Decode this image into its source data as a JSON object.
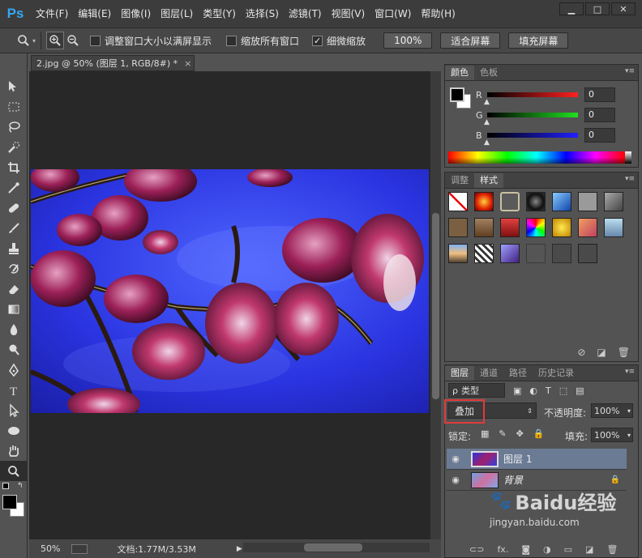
{
  "app": {
    "logo": "Ps"
  },
  "menu": [
    "文件(F)",
    "编辑(E)",
    "图像(I)",
    "图层(L)",
    "类型(Y)",
    "选择(S)",
    "滤镜(T)",
    "视图(V)",
    "窗口(W)",
    "帮助(H)"
  ],
  "window_controls": {
    "minimize": "▁",
    "maximize": "□",
    "close": "✕"
  },
  "options": {
    "resize_window": "调整窗口大小以满屏显示",
    "zoom_all": "缩放所有窗口",
    "scrubby_zoom": "细微缩放",
    "btn_100": "100%",
    "btn_fit": "适合屏幕",
    "btn_fill": "填充屏幕",
    "scrubby_checked_glyph": "✓"
  },
  "document": {
    "tab_title": "2.jpg @ 50% (图层 1, RGB/8#) *",
    "tab_close": "×",
    "zoom": "50%",
    "doc_info": "文档:1.77M/3.53M",
    "arrow": "▶"
  },
  "color_panel": {
    "tabs": [
      "颜色",
      "色板"
    ],
    "channels": [
      {
        "label": "R",
        "value": "0",
        "color": "#ff2020"
      },
      {
        "label": "G",
        "value": "0",
        "color": "#20e020"
      },
      {
        "label": "B",
        "value": "0",
        "color": "#2020ff"
      }
    ]
  },
  "styles_panel": {
    "tabs": [
      "调整",
      "样式"
    ]
  },
  "layers_panel": {
    "tabs": [
      "图层",
      "通道",
      "路径",
      "历史记录"
    ],
    "filter_kind": "类型",
    "filter_prefix": "ρ",
    "blend_mode": "叠加",
    "opacity_label": "不透明度:",
    "opacity_value": "100%",
    "lock_label": "锁定:",
    "fill_label": "填充:",
    "fill_value": "100%",
    "layers": [
      {
        "name": "图层 1",
        "selected": true
      },
      {
        "name": "背景",
        "locked": true,
        "italic": true
      }
    ],
    "bottom_icons": [
      "link-icon",
      "fx-icon",
      "mask-icon",
      "adjustment-icon",
      "folder-icon",
      "new-layer-icon",
      "trash-icon"
    ],
    "fx_glyph": "fx."
  },
  "watermark": {
    "text": "Baidu经验",
    "url": "jingyan.baidu.com"
  },
  "accent": {
    "ps_blue": "#33a8f0",
    "highlight_red": "#e23a3a",
    "selected_layer": "#6b7b94"
  }
}
